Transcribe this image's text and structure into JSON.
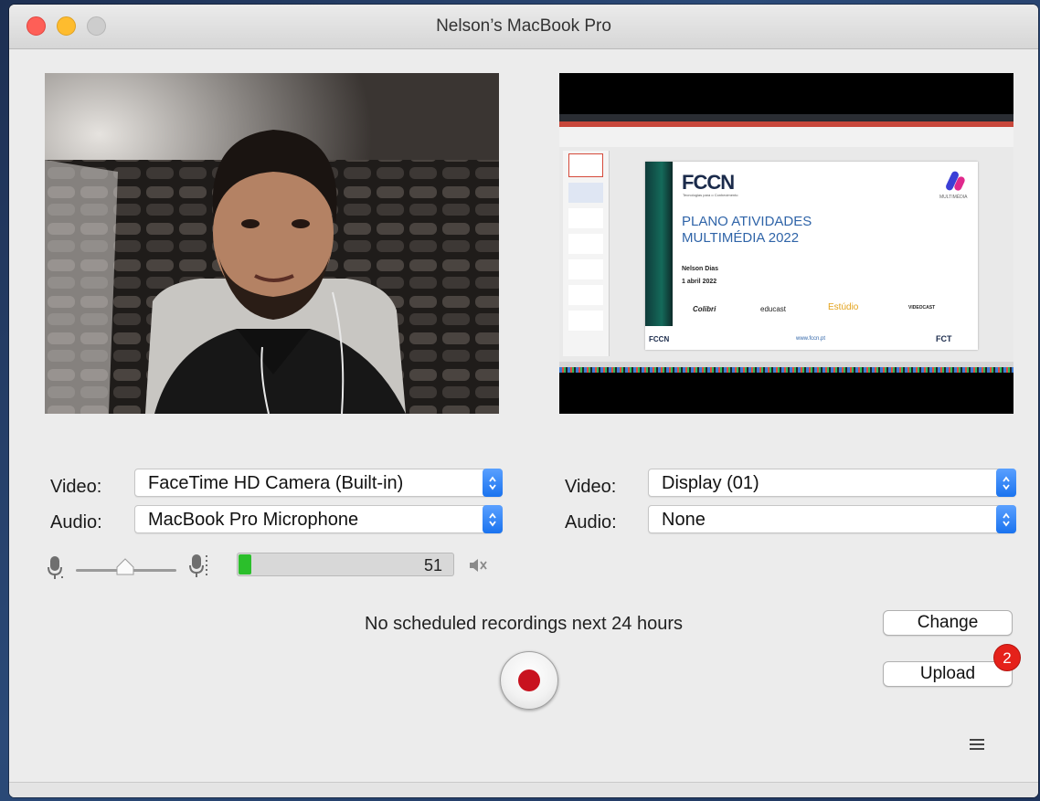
{
  "window": {
    "title": "Nelson’s MacBook Pro"
  },
  "camera_source": {
    "video_label": "Video:",
    "video_value": "FaceTime HD Camera (Built-in)",
    "audio_label": "Audio:",
    "audio_value": "MacBook Pro Microphone"
  },
  "screen_source": {
    "video_label": "Video:",
    "video_value": "Display (01)",
    "audio_label": "Audio:",
    "audio_value": "None"
  },
  "slide": {
    "logo": "FCCN",
    "tagline": "Tecnologias para o Conhecimento",
    "brand": "MULTIMÉDIA",
    "title_line1": "PLANO ATIVIDADES",
    "title_line2": "MULTIMÉDIA 2022",
    "author": "Nelson Dias",
    "date": "1 abril 2022",
    "services": [
      "Colibri",
      "educast",
      "Estúdio",
      "VIDEOCAST"
    ],
    "footer_left": "FCCN",
    "footer_url": "www.fccn.pt",
    "footer_right": "FCT"
  },
  "audio_level": {
    "value": "51",
    "fill_fraction": 0.06
  },
  "status": {
    "message": "No scheduled recordings next 24 hours"
  },
  "buttons": {
    "change": "Change",
    "upload": "Upload",
    "upload_badge": "2"
  },
  "colors": {
    "accent": "#1a73ef",
    "record": "#c8121f",
    "meter": "#2bbf2b",
    "badge": "#e5211a"
  },
  "icons": [
    "mic-low-icon",
    "mic-high-icon",
    "mute-speaker-icon",
    "record-icon",
    "menu-icon"
  ]
}
